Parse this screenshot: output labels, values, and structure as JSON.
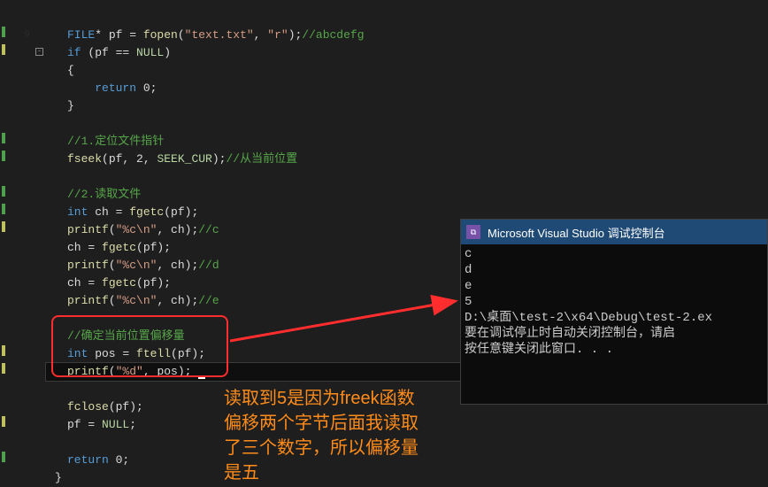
{
  "code": {
    "l1": {
      "a": "FILE",
      "b": "* pf = ",
      "c": "fopen",
      "d": "(",
      "e": "\"text.txt\"",
      "f": ", ",
      "g": "\"r\"",
      "h": ");",
      "i": "//abcdefg"
    },
    "l2": {
      "a": "if",
      "b": " (pf == ",
      "c": "NULL",
      "d": ")"
    },
    "l3": "{",
    "l4": {
      "a": "    ",
      "b": "return",
      "c": " 0;"
    },
    "l5": "}",
    "l6": {
      "a": "//1.定位文件指针"
    },
    "l7": {
      "a": "fseek",
      "b": "(pf, 2, ",
      "c": "SEEK_CUR",
      "d": ");",
      "e": "//从当前位置"
    },
    "l8": {
      "a": "//2.读取文件"
    },
    "l9": {
      "a": "int",
      "b": " ch = ",
      "c": "fgetc",
      "d": "(pf);"
    },
    "l10": {
      "a": "printf",
      "b": "(",
      "c": "\"%c\\n\"",
      "d": ", ch);",
      "e": "//c"
    },
    "l11": {
      "a": "ch = ",
      "b": "fgetc",
      "c": "(pf);"
    },
    "l12": {
      "a": "printf",
      "b": "(",
      "c": "\"%c\\n\"",
      "d": ", ch);",
      "e": "//d"
    },
    "l13": {
      "a": "ch = ",
      "b": "fgetc",
      "c": "(pf);"
    },
    "l14": {
      "a": "printf",
      "b": "(",
      "c": "\"%c\\n\"",
      "d": ", ch);",
      "e": "//e"
    },
    "l15": {
      "a": "//确定当前位置偏移量"
    },
    "l16": {
      "a": "int",
      "b": " pos = ",
      "c": "ftell",
      "d": "(pf);"
    },
    "l17": {
      "a": "printf",
      "b": "(",
      "c": "\"%d\"",
      "d": ", pos);"
    },
    "l18": {
      "a": "fclose",
      "b": "(pf);"
    },
    "l19": {
      "a": "pf = ",
      "b": "NULL",
      "c": ";"
    },
    "l20": {
      "a": "return",
      "b": " 0;"
    },
    "l21": "}"
  },
  "console": {
    "title": "Microsoft Visual Studio 调试控制台",
    "out1": "c",
    "out2": "d",
    "out3": "e",
    "out4": "5",
    "path": "D:\\桌面\\test-2\\x64\\Debug\\test-2.ex",
    "msg1": "要在调试停止时自动关闭控制台，请启",
    "msg2": "按任意键关闭此窗口. . ."
  },
  "annotation": {
    "ln1": "读取到5是因为freek函数",
    "ln2": "偏移两个字节后面我读取",
    "ln3": "了三个数字，所以偏移量",
    "ln4": "是五"
  }
}
